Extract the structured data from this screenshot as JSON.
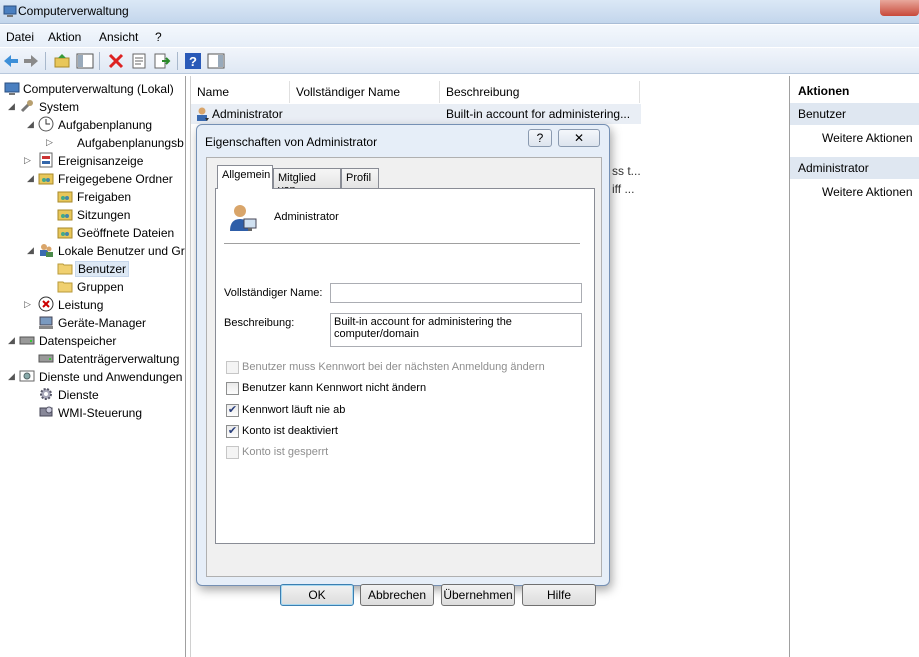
{
  "window": {
    "title": "Computerverwaltung"
  },
  "menu": [
    "Datei",
    "Aktion",
    "Ansicht",
    "?"
  ],
  "tree": [
    {
      "label": "Computerverwaltung (Lokal)"
    },
    {
      "label": "System"
    },
    {
      "label": "Aufgabenplanung"
    },
    {
      "label": "Aufgabenplanungsb"
    },
    {
      "label": "Ereignisanzeige"
    },
    {
      "label": "Freigegebene Ordner"
    },
    {
      "label": "Freigaben"
    },
    {
      "label": "Sitzungen"
    },
    {
      "label": "Geöffnete Dateien"
    },
    {
      "label": "Lokale Benutzer und Gr"
    },
    {
      "label": "Benutzer"
    },
    {
      "label": "Gruppen"
    },
    {
      "label": "Leistung"
    },
    {
      "label": "Geräte-Manager"
    },
    {
      "label": "Datenspeicher"
    },
    {
      "label": "Datenträgerverwaltung"
    },
    {
      "label": "Dienste und Anwendungen"
    },
    {
      "label": "Dienste"
    },
    {
      "label": "WMI-Steuerung"
    }
  ],
  "list": {
    "columns": [
      "Name",
      "Vollständiger Name",
      "Beschreibung"
    ],
    "rows": [
      {
        "name": "Administrator",
        "fullname": "",
        "description": "Built-in account for administering..."
      }
    ],
    "peek": [
      "ss t...",
      "iff ..."
    ]
  },
  "actions": {
    "header": "Aktionen",
    "sections": [
      {
        "title": "Benutzer",
        "item": "Weitere Aktionen"
      },
      {
        "title": "Administrator",
        "item": "Weitere Aktionen"
      }
    ]
  },
  "dialog": {
    "title": "Eigenschaften von Administrator",
    "help_glyph": "?",
    "close_glyph": "✕",
    "tabs": [
      "Allgemein",
      "Mitglied von",
      "Profil"
    ],
    "username": "Administrator",
    "fullname_label": "Vollständiger Name:",
    "fullname_value": "",
    "description_label": "Beschreibung:",
    "description_value": "Built-in account for administering the computer/domain",
    "checkboxes": [
      {
        "label": "Benutzer muss Kennwort bei der nächsten Anmeldung ändern",
        "checked": false,
        "enabled": false
      },
      {
        "label": "Benutzer kann Kennwort nicht ändern",
        "checked": false,
        "enabled": true
      },
      {
        "label": "Kennwort läuft nie ab",
        "checked": true,
        "enabled": true
      },
      {
        "label": "Konto ist deaktiviert",
        "checked": true,
        "enabled": true
      },
      {
        "label": "Konto ist gesperrt",
        "checked": false,
        "enabled": false
      }
    ],
    "buttons": {
      "ok": "OK",
      "cancel": "Abbrechen",
      "apply": "Übernehmen",
      "help": "Hilfe"
    }
  }
}
